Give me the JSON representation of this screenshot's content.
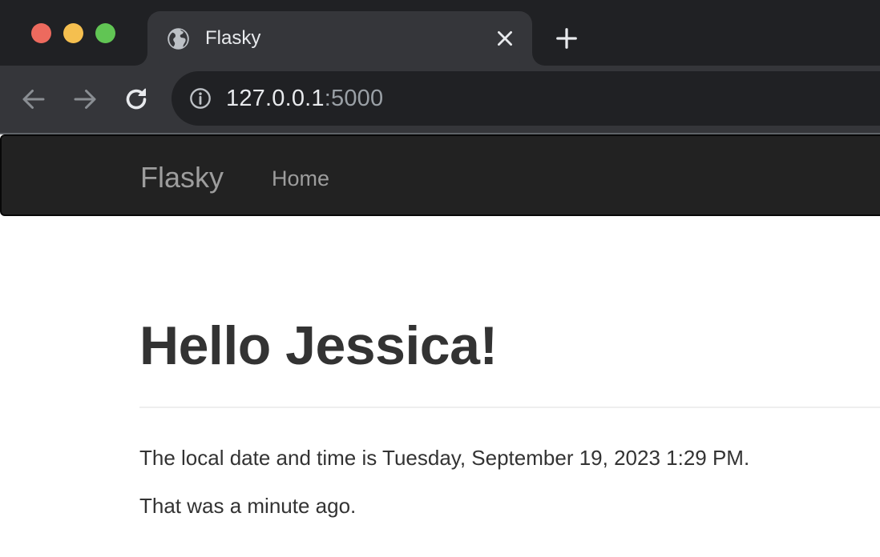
{
  "browser": {
    "tab": {
      "title": "Flasky",
      "favicon": "globe-icon"
    },
    "address_bar": {
      "host": "127.0.0.1",
      "port": ":5000",
      "security_icon": "info-icon"
    },
    "buttons": {
      "close_tab": "close-icon",
      "new_tab": "plus-icon",
      "back": "arrow-left-icon",
      "forward": "arrow-right-icon",
      "reload": "reload-icon"
    },
    "colors": {
      "frame": "#202124",
      "toolbar": "#35363a",
      "close": "#ed6a5e",
      "minimize": "#f5bf4f",
      "maximize": "#61c554"
    }
  },
  "page": {
    "navbar": {
      "brand": "Flasky",
      "links": [
        "Home"
      ]
    },
    "heading": "Hello Jessica!",
    "datetime_text": "The local date and time is Tuesday, September 19, 2023 1:29 PM.",
    "relative_text": "That was a minute ago.",
    "colors": {
      "navbar_bg": "#222222",
      "navbar_link": "#9d9d9d",
      "text": "#333333"
    }
  }
}
